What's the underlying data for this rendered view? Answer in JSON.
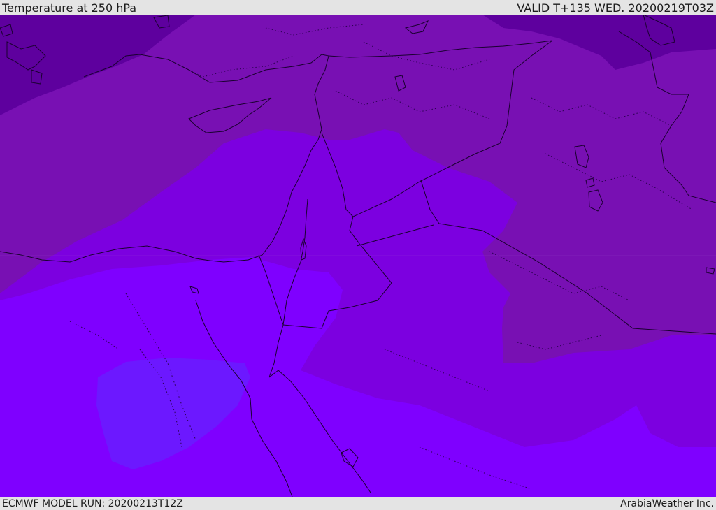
{
  "header": {
    "title": "Temperature at 250 hPa",
    "valid": "VALID T+135 WED. 20200219T03Z"
  },
  "footer": {
    "model_run": "ECMWF MODEL RUN: 20200213T12Z",
    "credit": "ArabiaWeather Inc."
  },
  "colors": {
    "coldest": "#5e009e",
    "cold": "#7810b3",
    "mid": "#7c00e0",
    "warm": "#7f00ff",
    "warmest": "#6c18ff",
    "borders": "#1a0030"
  }
}
